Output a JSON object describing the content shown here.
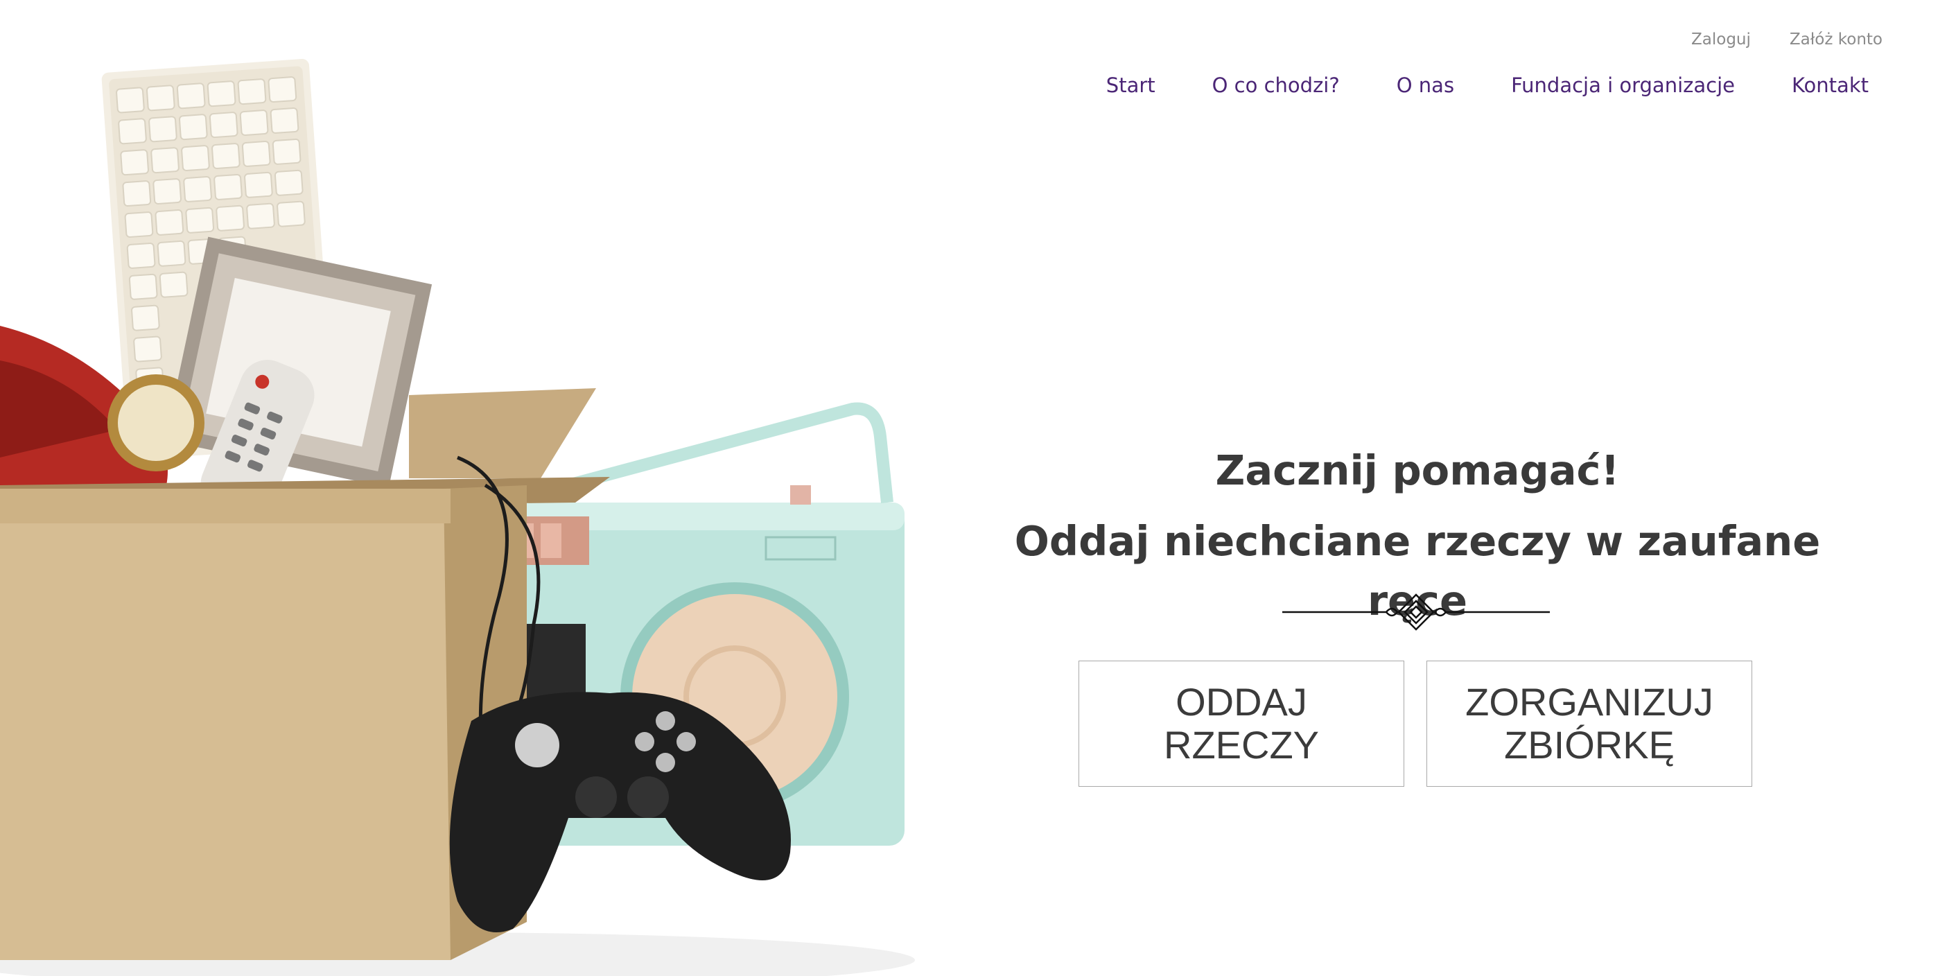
{
  "auth": {
    "login": "Zaloguj",
    "register": "Załóż konto"
  },
  "nav": [
    {
      "label": "Start"
    },
    {
      "label": "O co chodzi?"
    },
    {
      "label": "O nas"
    },
    {
      "label": "Fundacja i organizacje"
    },
    {
      "label": "Kontakt"
    }
  ],
  "hero": {
    "title": "Zacznij pomagać!",
    "subtitle": "Oddaj niechciane rzeczy w zaufane ręce"
  },
  "cta": {
    "give": {
      "line1": "ODDAJ",
      "line2": "RZECZY"
    },
    "organize": {
      "line1": "ZORGANIZUJ",
      "line2": "ZBIÓRKĘ"
    }
  },
  "colors": {
    "nav": "#4b2676",
    "auth": "#8a8a8a",
    "heading": "#3a3a3a",
    "button_border": "#a9a9a9"
  }
}
